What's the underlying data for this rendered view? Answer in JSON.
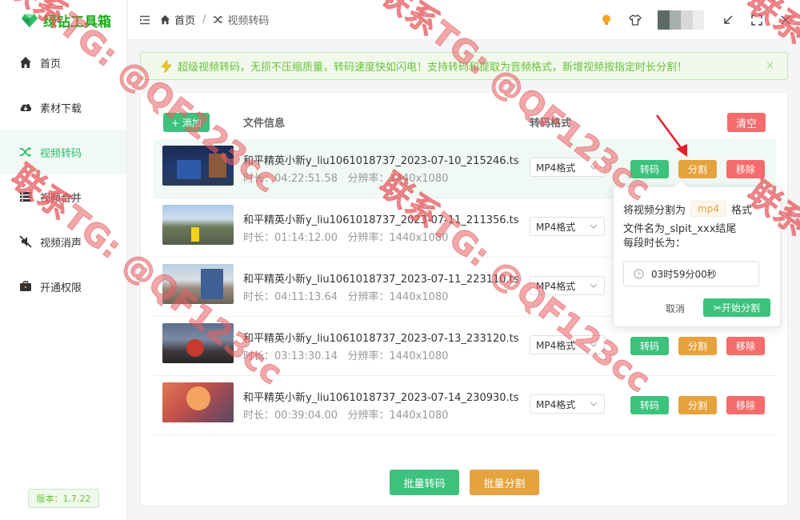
{
  "app": {
    "name": "绿钻工具箱",
    "version": "版本：1.7.22"
  },
  "sidebar": {
    "items": [
      {
        "label": "首页",
        "icon": "home-icon",
        "active": false
      },
      {
        "label": "素材下载",
        "icon": "cloud-download-icon",
        "active": false
      },
      {
        "label": "视频转码",
        "icon": "shuffle-icon",
        "active": true
      },
      {
        "label": "视频合并",
        "icon": "merge-icon",
        "active": false
      },
      {
        "label": "视频消声",
        "icon": "mute-icon",
        "active": false
      },
      {
        "label": "开通权限",
        "icon": "briefcase-icon",
        "active": false
      }
    ]
  },
  "breadcrumb": {
    "home": "首页",
    "separator": "/",
    "current": "视频转码"
  },
  "alert": {
    "text": "超级视频转码，无损不压缩质量，转码速度快如闪电！支持转码和提取为音频格式，新增视频按指定时长分割！",
    "close": "×"
  },
  "toolbar": {
    "add": "+ 添加",
    "clear": "清空"
  },
  "table": {
    "headers": {
      "info": "文件信息",
      "format": "转码格式"
    },
    "duration_label": "时长：",
    "resolution_label": "分辨率：",
    "actions": {
      "convert": "转码",
      "split": "分割",
      "remove": "移除"
    },
    "rows": [
      {
        "name": "和平精英小新y_liu1061018737_2023-07-10_215246.ts",
        "duration": "04:22:51.58",
        "resolution": "1440x1080",
        "format": "MP4格式"
      },
      {
        "name": "和平精英小新y_liu1061018737_2023-07-11_211356.ts",
        "duration": "01:14:12.00",
        "resolution": "1440x1080",
        "format": "MP4格式"
      },
      {
        "name": "和平精英小新y_liu1061018737_2023-07-11_223110.ts",
        "duration": "04:11:13.64",
        "resolution": "1440x1080",
        "format": "MP4格式"
      },
      {
        "name": "和平精英小新y_liu1061018737_2023-07-13_233120.ts",
        "duration": "03:13:30.14",
        "resolution": "1440x1080",
        "format": "MP4格式"
      },
      {
        "name": "和平精英小新y_liu1061018737_2023-07-14_230930.ts",
        "duration": "00:39:04.00",
        "resolution": "1440x1080",
        "format": "MP4格式"
      }
    ]
  },
  "popover": {
    "line1_prefix": "将视频分割为",
    "format_tag": "mp4",
    "line1_suffix": "格式",
    "line2": "文件名为_slpit_xxx结尾",
    "line3": "每段时长为：",
    "time_value": "03时59分00秒",
    "cancel": "取消",
    "start": "✂开始分割"
  },
  "footer": {
    "batch_convert": "批量转码",
    "batch_split": "批量分割"
  },
  "watermark": "联系TG: @QF123cc",
  "colors": {
    "primary": "#3cc27d",
    "warning": "#e6a23c",
    "danger": "#f56c6c",
    "alert_bg": "#f0f9eb"
  }
}
